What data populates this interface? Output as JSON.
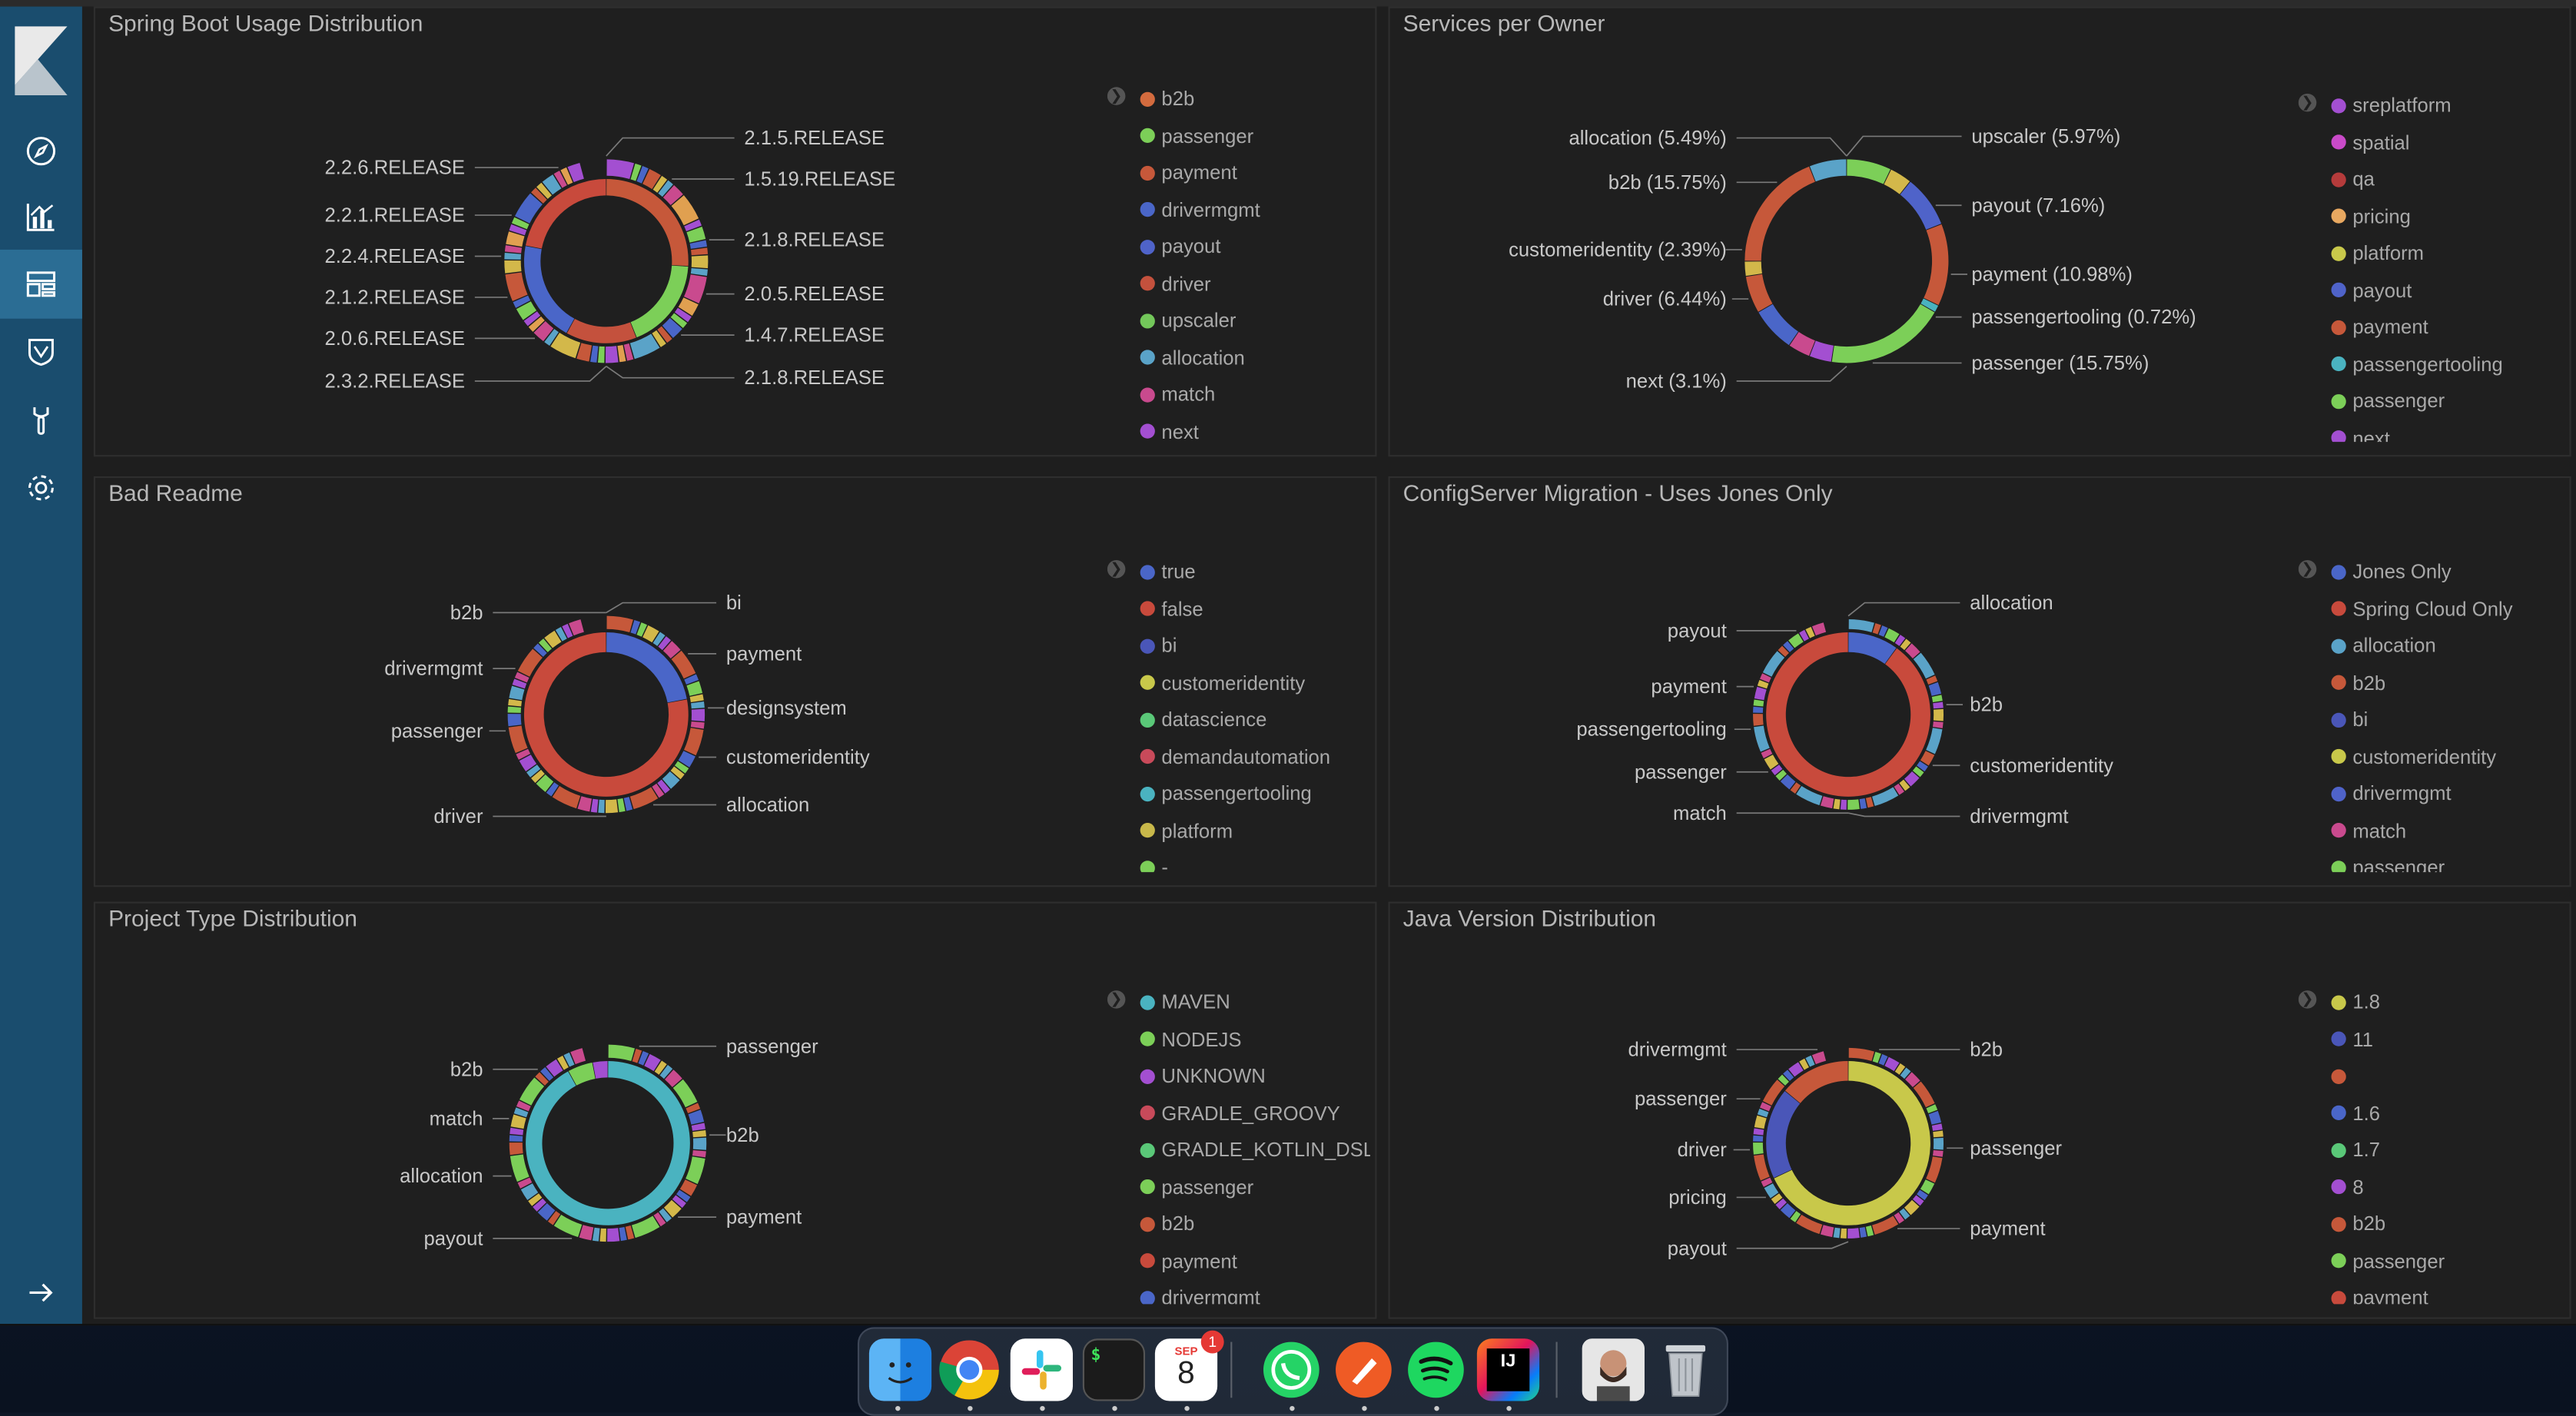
{
  "nav": {
    "items": [
      "Discover",
      "Visualize",
      "Dashboard",
      "Timelion",
      "Dev Tools",
      "Management"
    ],
    "collapse_icon": "arrow-right-icon"
  },
  "panels": [
    {
      "title": "Spring Boot Usage Distribution",
      "legend": [
        {
          "label": "b2b",
          "color": "#d36b3e"
        },
        {
          "label": "passenger",
          "color": "#7ccf58"
        },
        {
          "label": "payment",
          "color": "#c6583a"
        },
        {
          "label": "drivermgmt",
          "color": "#4a66c8"
        },
        {
          "label": "payout",
          "color": "#4f63c9"
        },
        {
          "label": "driver",
          "color": "#c4513d"
        },
        {
          "label": "upscaler",
          "color": "#73c75a"
        },
        {
          "label": "allocation",
          "color": "#5aa3c8"
        },
        {
          "label": "match",
          "color": "#c94a8e"
        },
        {
          "label": "next",
          "color": "#a34fd1"
        }
      ],
      "labels": {
        "left": [
          "2.2.6.RELEASE",
          "2.2.1.RELEASE",
          "2.2.4.RELEASE",
          "2.1.2.RELEASE",
          "2.0.6.RELEASE",
          "2.3.2.RELEASE"
        ],
        "right": [
          "2.1.5.RELEASE",
          "1.5.19.RELEASE",
          "2.1.8.RELEASE",
          "2.0.5.RELEASE",
          "1.4.7.RELEASE",
          "2.1.8.RELEASE"
        ]
      },
      "ring": {
        "inner": [
          [
            "#c6583a",
            26
          ],
          [
            "#7ccf58",
            18
          ],
          [
            "#c4513d",
            14
          ],
          [
            "#4a66c8",
            20
          ],
          [
            "#c84a3c",
            22
          ]
        ],
        "outer_pattern": [
          "#a34fd1",
          "#7ccf58",
          "#4a66c8",
          "#c6583a",
          "#d3b84a",
          "#5aa3c8",
          "#c94a8e",
          "#e0a050"
        ]
      }
    },
    {
      "title": "Services per Owner",
      "legend": [
        {
          "label": "sreplatform",
          "color": "#a34fd1"
        },
        {
          "label": "spatial",
          "color": "#c94ac8"
        },
        {
          "label": "qa",
          "color": "#b53b3b"
        },
        {
          "label": "pricing",
          "color": "#e8a860"
        },
        {
          "label": "platform",
          "color": "#c8c84a"
        },
        {
          "label": "payout",
          "color": "#4f63c9"
        },
        {
          "label": "payment",
          "color": "#c6583a"
        },
        {
          "label": "passengertooling",
          "color": "#4ab3c0"
        },
        {
          "label": "passenger",
          "color": "#7ccf58"
        },
        {
          "label": "next",
          "color": "#a34fd1"
        }
      ],
      "labels": {
        "left": [
          "allocation (5.49%)",
          "b2b (15.75%)",
          "customeridentity (2.39%)",
          "driver (6.44%)",
          "next (3.1%)"
        ],
        "right": [
          "upscaler (5.97%)",
          "payout (7.16%)",
          "payment (10.98%)",
          "passengertooling (0.72%)",
          "passenger (15.75%)"
        ]
      },
      "ring": {
        "inner": [
          [
            "#7ccf58",
            6
          ],
          [
            "#d3b84a",
            3
          ],
          [
            "#4f63c9",
            7
          ],
          [
            "#c6583a",
            11
          ],
          [
            "#4ab3c0",
            1
          ],
          [
            "#7ccf58",
            16
          ],
          [
            "#a34fd1",
            3
          ],
          [
            "#c94a8e",
            3
          ],
          [
            "#4a66c8",
            6
          ],
          [
            "#c6583a",
            5
          ],
          [
            "#d3b84a",
            2
          ],
          [
            "#c6583a",
            16
          ],
          [
            "#5aa3c8",
            5
          ]
        ],
        "outer_pattern": []
      }
    },
    {
      "title": "Bad Readme",
      "legend": [
        {
          "label": "true",
          "color": "#4a66c8"
        },
        {
          "label": "false",
          "color": "#c84a3c"
        },
        {
          "label": "bi",
          "color": "#4a56b8"
        },
        {
          "label": "customeridentity",
          "color": "#c8c84a"
        },
        {
          "label": "datascience",
          "color": "#5ac878"
        },
        {
          "label": "demandautomation",
          "color": "#c84a5a"
        },
        {
          "label": "passengertooling",
          "color": "#4ab3c0"
        },
        {
          "label": "platform",
          "color": "#c8b84a"
        },
        {
          "label": "-",
          "color": "#7ccf58"
        }
      ],
      "labels": {
        "left": [
          "b2b",
          "drivermgmt",
          "passenger",
          "driver"
        ],
        "right": [
          "bi",
          "payment",
          "designsystem",
          "customeridentity",
          "allocation"
        ]
      },
      "ring": {
        "inner": [
          [
            "#4a66c8",
            22
          ],
          [
            "#c84a3c",
            78
          ]
        ],
        "outer_pattern": [
          "#c6583a",
          "#4a66c8",
          "#7ccf58",
          "#d3b84a",
          "#5aa3c8",
          "#a34fd1",
          "#c94a8e"
        ]
      }
    },
    {
      "title": "ConfigServer Migration - Uses Jones Only",
      "legend": [
        {
          "label": "Jones Only",
          "color": "#4a66c8"
        },
        {
          "label": "Spring Cloud Only",
          "color": "#c84a3c"
        },
        {
          "label": "allocation",
          "color": "#5aa3c8"
        },
        {
          "label": "b2b",
          "color": "#c6583a"
        },
        {
          "label": "bi",
          "color": "#4a56b8"
        },
        {
          "label": "customeridentity",
          "color": "#c8c84a"
        },
        {
          "label": "drivermgmt",
          "color": "#4f63c9"
        },
        {
          "label": "match",
          "color": "#c94a8e"
        },
        {
          "label": "passenger",
          "color": "#7ccf58"
        }
      ],
      "labels": {
        "left": [
          "payout",
          "payment",
          "passengertooling",
          "passenger",
          "match"
        ],
        "right": [
          "allocation",
          "b2b",
          "customeridentity",
          "drivermgmt"
        ]
      },
      "ring": {
        "inner": [
          [
            "#4a66c8",
            10
          ],
          [
            "#c84a3c",
            90
          ]
        ],
        "outer_pattern": [
          "#5aa3c8",
          "#c6583a",
          "#4a66c8",
          "#7ccf58",
          "#a34fd1",
          "#d3b84a",
          "#c94a8e"
        ]
      }
    },
    {
      "title": "Project Type Distribution",
      "legend": [
        {
          "label": "MAVEN",
          "color": "#4ab3c0"
        },
        {
          "label": "NODEJS",
          "color": "#7ccf58"
        },
        {
          "label": "UNKNOWN",
          "color": "#a34fd1"
        },
        {
          "label": "GRADLE_GROOVY",
          "color": "#c84a5a"
        },
        {
          "label": "GRADLE_KOTLIN_DSL",
          "color": "#5ac878"
        },
        {
          "label": "passenger",
          "color": "#7ccf58"
        },
        {
          "label": "b2b",
          "color": "#c6583a"
        },
        {
          "label": "payment",
          "color": "#c84a3c"
        },
        {
          "label": "drivermgmt",
          "color": "#4a66c8"
        }
      ],
      "labels": {
        "left": [
          "b2b",
          "match",
          "allocation",
          "payout"
        ],
        "right": [
          "passenger",
          "b2b",
          "payment"
        ]
      },
      "ring": {
        "inner": [
          [
            "#4ab3c0",
            92
          ],
          [
            "#7ccf58",
            5
          ],
          [
            "#a34fd1",
            3
          ]
        ],
        "outer_pattern": [
          "#7ccf58",
          "#c6583a",
          "#4a66c8",
          "#a34fd1",
          "#d3b84a",
          "#5aa3c8",
          "#c94a8e"
        ]
      }
    },
    {
      "title": "Java Version Distribution",
      "legend": [
        {
          "label": "1.8",
          "color": "#c8c84a"
        },
        {
          "label": "11",
          "color": "#4a56b8"
        },
        {
          "label": "",
          "color": "#c6583a"
        },
        {
          "label": "1.6",
          "color": "#4a66c8"
        },
        {
          "label": "1.7",
          "color": "#5ac878"
        },
        {
          "label": "8",
          "color": "#a34fd1"
        },
        {
          "label": "b2b",
          "color": "#c6583a"
        },
        {
          "label": "passenger",
          "color": "#7ccf58"
        },
        {
          "label": "payment",
          "color": "#c84a3c"
        }
      ],
      "labels": {
        "left": [
          "drivermgmt",
          "passenger",
          "driver",
          "pricing",
          "payout"
        ],
        "right": [
          "b2b",
          "passenger",
          "payment"
        ]
      },
      "ring": {
        "inner": [
          [
            "#c8c84a",
            68
          ],
          [
            "#4a56b8",
            18
          ],
          [
            "#c6583a",
            14
          ]
        ],
        "outer_pattern": [
          "#c6583a",
          "#7ccf58",
          "#4a66c8",
          "#a34fd1",
          "#d3b84a",
          "#5aa3c8",
          "#c94a8e"
        ]
      }
    }
  ],
  "dock": {
    "apps": [
      "Finder",
      "Chrome",
      "Slack",
      "Terminal",
      "Calendar",
      "WhatsApp",
      "Postman",
      "Spotify",
      "IntelliJ IDEA",
      "Contacts",
      "Trash"
    ],
    "calendar_month": "SEP",
    "calendar_day": "8",
    "calendar_badge": "1",
    "terminal_prompt": "$"
  }
}
